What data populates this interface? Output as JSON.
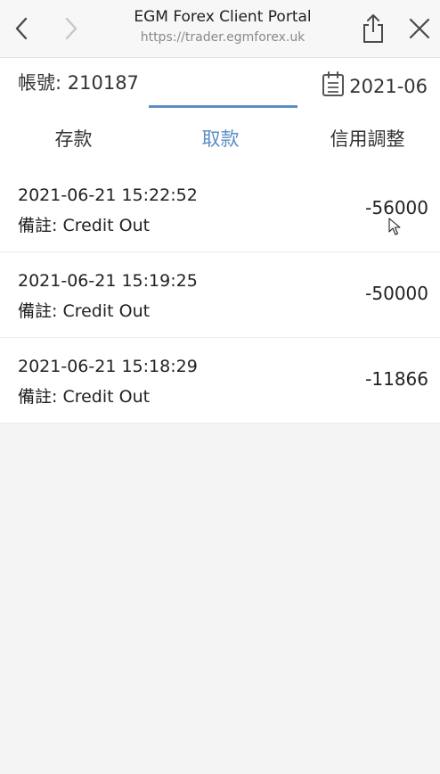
{
  "browser": {
    "title": "EGM Forex Client Portal",
    "url": "https://trader.egmforex.uk"
  },
  "account": {
    "label": "帳號: 210187",
    "month": "2021-06"
  },
  "tabs": [
    {
      "label": "存款"
    },
    {
      "label": "取款"
    },
    {
      "label": "信用調整"
    }
  ],
  "records": [
    {
      "date": "2021-06-21 15:22:52",
      "note": "備註: Credit Out",
      "amount": "-56000"
    },
    {
      "date": "2021-06-21 15:19:25",
      "note": "備註: Credit Out",
      "amount": "-50000"
    },
    {
      "date": "2021-06-21 15:18:29",
      "note": "備註: Credit Out",
      "amount": "-11866"
    }
  ],
  "colors": {
    "accent": "#5b8fc4",
    "text": "#222222",
    "background": "#f4f4f4"
  },
  "icons": {
    "back": "chevron-left-icon",
    "forward": "chevron-right-icon",
    "share": "share-icon",
    "close": "close-icon",
    "calendar": "calendar-icon",
    "cursor": "mouse-pointer-icon"
  }
}
